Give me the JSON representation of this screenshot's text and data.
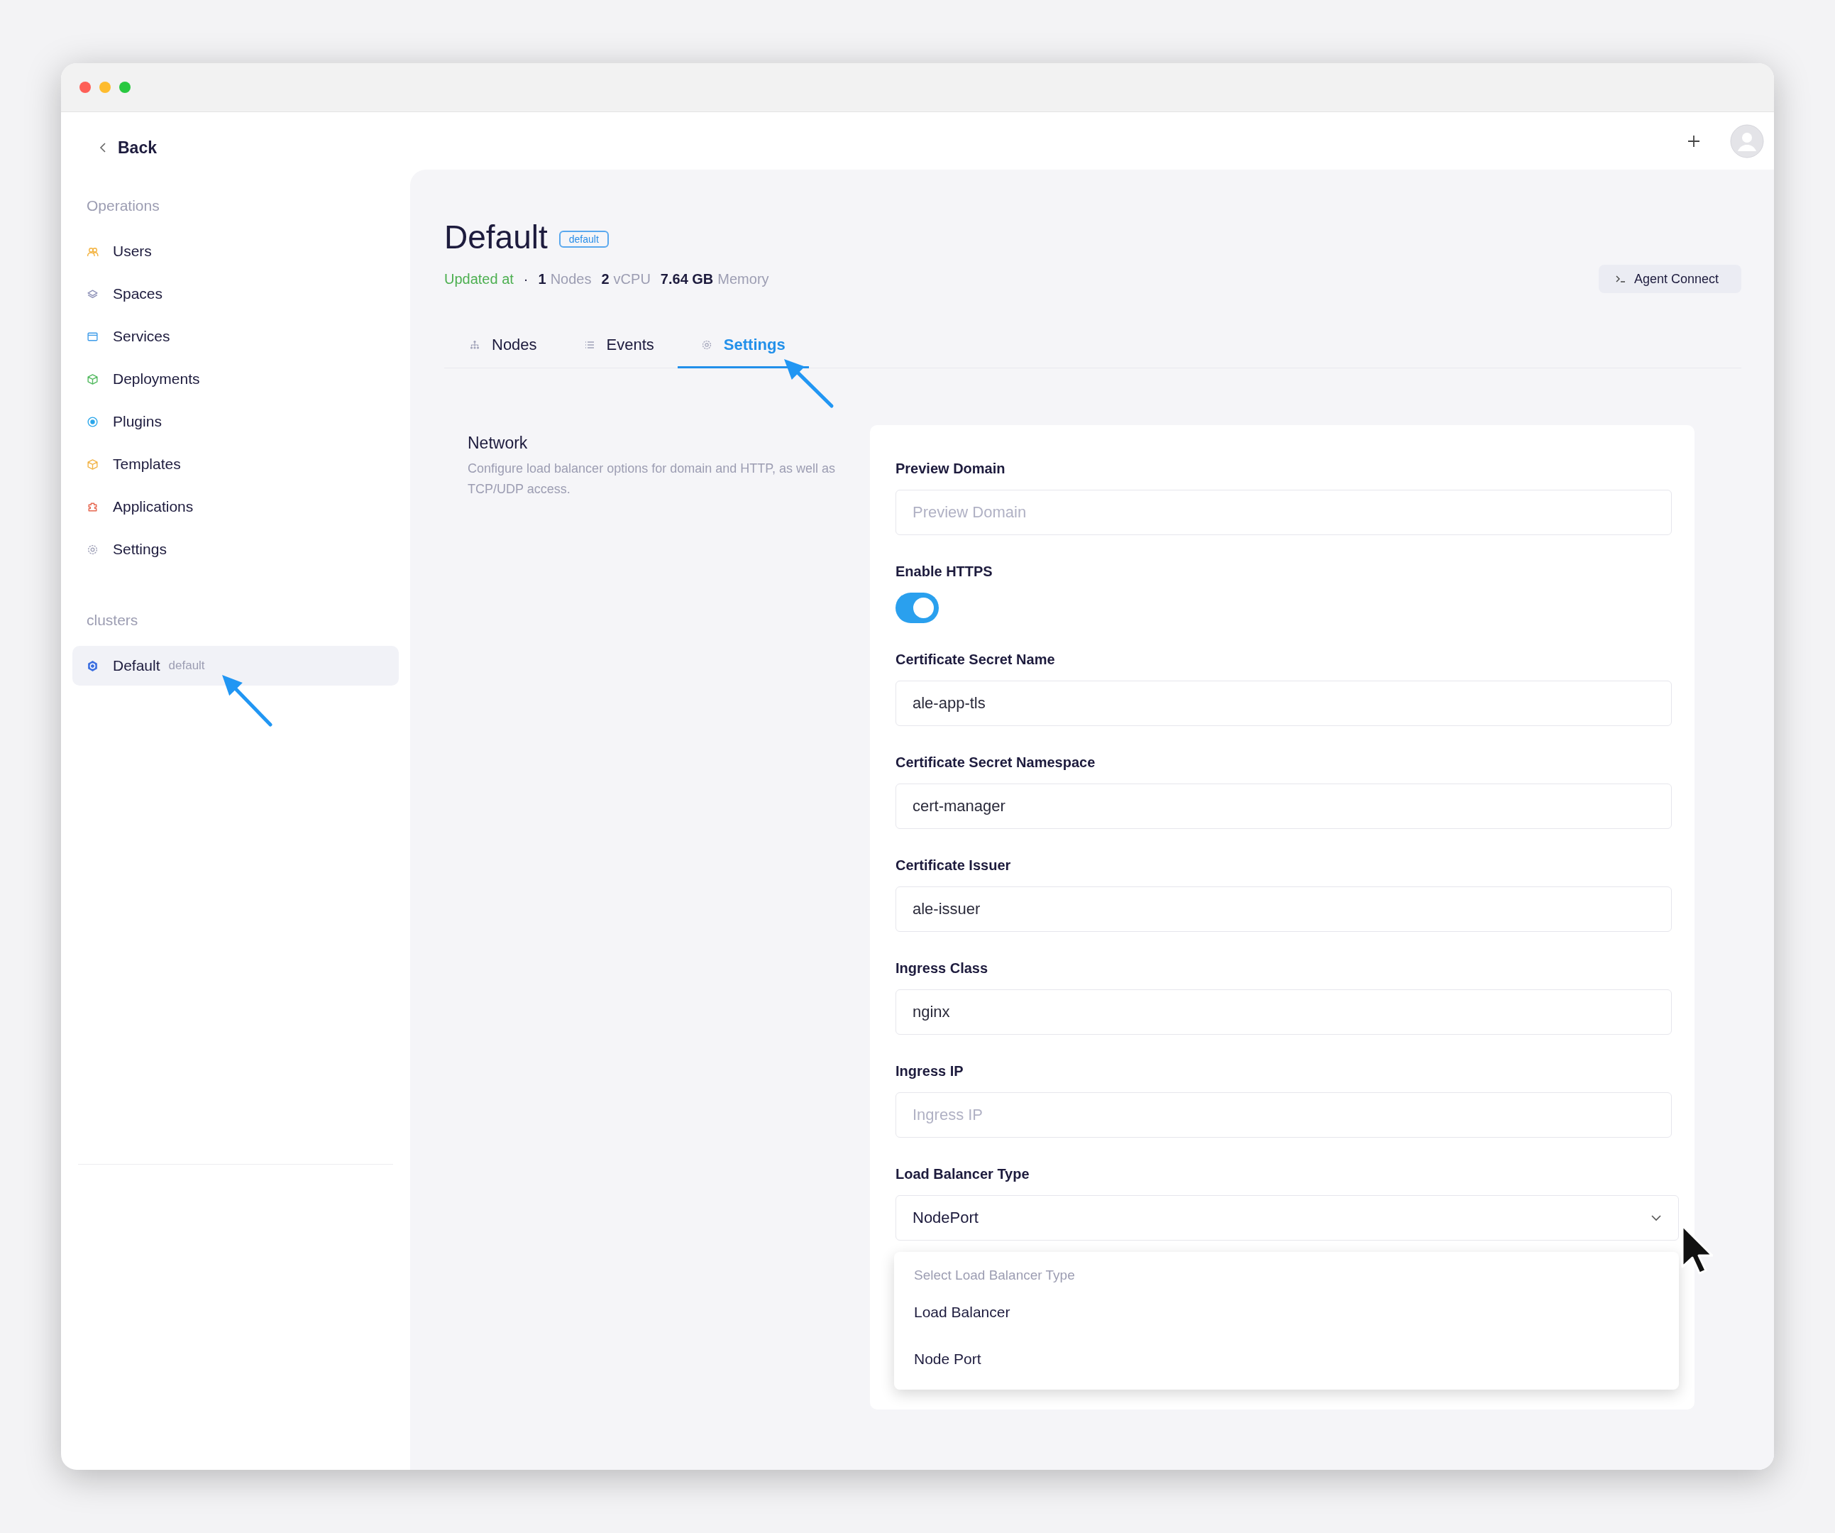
{
  "sidebar": {
    "back": "Back",
    "section": "Operations",
    "items": [
      {
        "label": "Users",
        "color": "#f3b23e",
        "selected": false
      },
      {
        "label": "Spaces",
        "color": "#8e92b8",
        "selected": false
      },
      {
        "label": "Services",
        "color": "#3d9be9",
        "selected": false
      },
      {
        "label": "Deployments",
        "color": "#52b95f",
        "selected": false
      },
      {
        "label": "Plugins",
        "color": "#2aa6ea",
        "selected": false
      },
      {
        "label": "Templates",
        "color": "#f2b447",
        "selected": false
      },
      {
        "label": "Applications",
        "color": "#e6664f",
        "selected": false
      },
      {
        "label": "Settings",
        "color": "#9a9cb4",
        "selected": false
      }
    ],
    "clusters_heading": "clusters",
    "clusters": [
      {
        "name": "Default",
        "tag": "default",
        "selected": true
      }
    ]
  },
  "header": {
    "title": "Default",
    "badge": "default",
    "updated": "Updated at",
    "separator": "·",
    "stats": [
      {
        "value": "1",
        "unit": "Nodes"
      },
      {
        "value": "2",
        "unit": "vCPU"
      },
      {
        "value": "7.64 GB",
        "unit": "Memory"
      }
    ],
    "agent_button": "Agent Connect"
  },
  "tabs": [
    {
      "label": "Nodes",
      "selected": false
    },
    {
      "label": "Events",
      "selected": false
    },
    {
      "label": "Settings",
      "selected": true
    }
  ],
  "section": {
    "title": "Network",
    "description": "Configure load balancer options for domain and HTTP, as well as TCP/UDP access."
  },
  "fields": [
    {
      "kind": "text",
      "label": "Preview Domain",
      "placeholder": "Preview Domain"
    },
    {
      "kind": "toggle",
      "label": "Enable HTTPS",
      "on": true
    },
    {
      "kind": "text",
      "label": "Certificate Secret Name",
      "value": "ale-app-tls"
    },
    {
      "kind": "text",
      "label": "Certificate Secret Namespace",
      "value": "cert-manager"
    },
    {
      "kind": "text",
      "label": "Certificate Issuer",
      "value": "ale-issuer"
    },
    {
      "kind": "text",
      "label": "Ingress Class",
      "value": "nginx"
    },
    {
      "kind": "text",
      "label": "Ingress IP",
      "placeholder": "Ingress IP"
    },
    {
      "kind": "select",
      "label": "Load Balancer Type",
      "value": "NodePort",
      "dropdown": {
        "header": "Select Load Balancer Type",
        "options": [
          "Load Balancer",
          "Node Port"
        ]
      }
    }
  ]
}
